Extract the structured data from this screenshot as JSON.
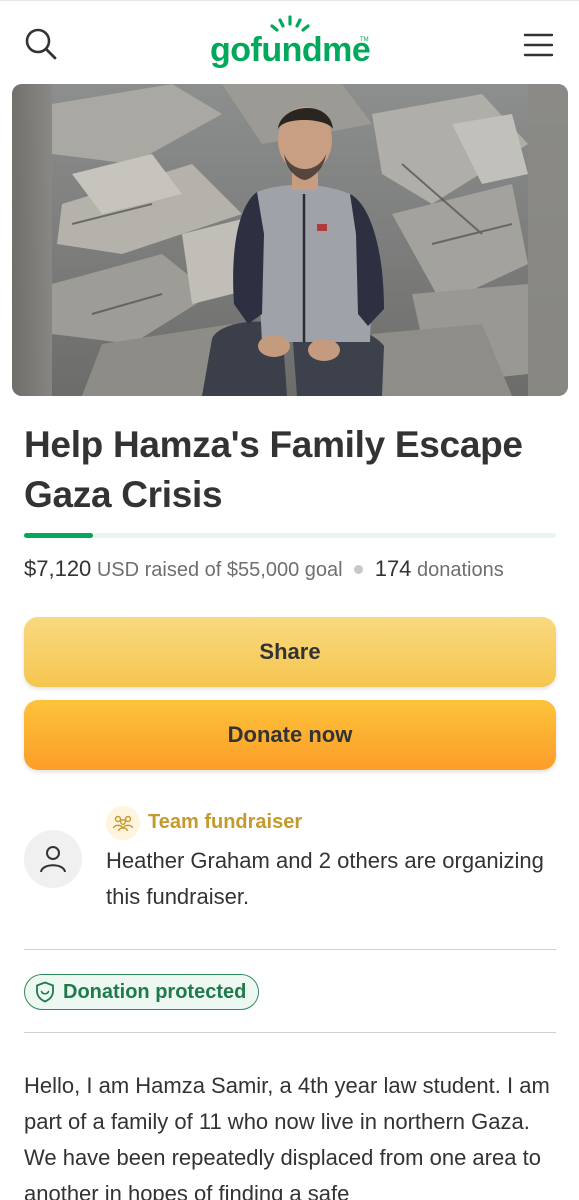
{
  "header": {
    "logo_text": "gofundme",
    "logo_tm": "TM",
    "brand_color": "#02a95c",
    "search_icon": "search-icon",
    "menu_icon": "hamburger-menu-icon"
  },
  "hero": {
    "image_alt": "Young man in a grey and navy zip jacket sitting on concrete rubble of destroyed buildings"
  },
  "campaign": {
    "title": "Help Hamza's Family Escape Gaza Crisis",
    "raised_amount": "$7,120",
    "raised_currency": "USD raised of $55,000 goal",
    "donation_count": "174",
    "donation_label": "donations",
    "progress_fraction": 0.13
  },
  "actions": {
    "share_label": "Share",
    "donate_label": "Donate now"
  },
  "organizer": {
    "team_label": "Team fundraiser",
    "team_icon": "people-icon",
    "avatar_icon": "user-icon",
    "text": "Heather Graham and 2 others are organizing this fundraiser."
  },
  "protection": {
    "label": "Donation protected",
    "icon": "shield-icon"
  },
  "story": {
    "text": "Hello, I am Hamza Samir, a 4th year law student. I am part of a family of 11 who now live in northern Gaza. We have been repeatedly displaced from one area to another in hopes of finding a safe"
  }
}
